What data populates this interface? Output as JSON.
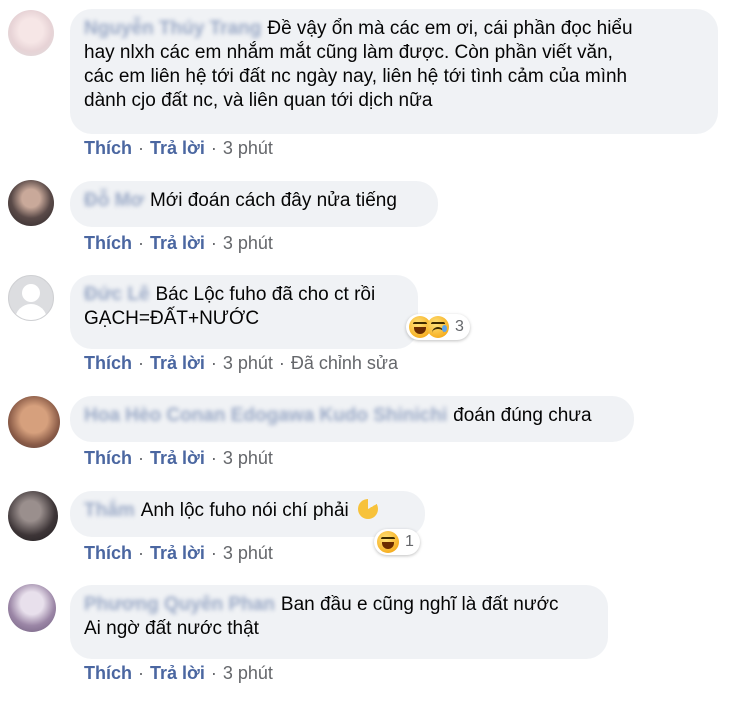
{
  "colors": {
    "link": "#4b67a1",
    "meta": "#65676b",
    "bubble": "#f0f2f5"
  },
  "actions": {
    "like": "Thích",
    "reply": "Trả lời",
    "dot": "·"
  },
  "comments": [
    {
      "author": "Nguyễn Thúy Trang",
      "lines": [
        "Đề vậy ổn mà các em ơi, cái phần đọc hiểu",
        "hay nlxh các em nhắm mắt cũng làm được. Còn phần viết văn,",
        "các em liên hệ tới đất nc ngày nay, liên hệ tới tình cảm của mình",
        "dành cjo đất nc, và liên quan tới dịch nữa"
      ],
      "time": "3 phút"
    },
    {
      "author": "Đỗ Mơ",
      "lines": [
        "Mới đoán cách đây nửa tiếng"
      ],
      "time": "3 phút"
    },
    {
      "author": "Đức Lê",
      "lines": [
        "Bác Lộc fuho đã cho ct rồi",
        "GẠCH=ĐẤT+NƯỚC"
      ],
      "time": "3 phút",
      "edited": "Đã chỉnh sửa",
      "reaction_icons": [
        "haha-icon",
        "sad-icon"
      ],
      "reaction_count": "3"
    },
    {
      "author": "Hoa Hèo Conan Edogawa Kudo Shinichi",
      "lines": [
        "đoán đúng chưa"
      ],
      "time": "3 phút"
    },
    {
      "author": "Thắm",
      "lines": [
        "Anh lộc fuho nói chí phải"
      ],
      "time": "3 phút",
      "reaction_icons": [
        "haha-icon"
      ],
      "reaction_count": "1"
    },
    {
      "author": "Phương Quyên Phan",
      "lines": [
        "Ban đầu e cũng nghĩ là đất nước",
        "Ai ngờ đất nước thật"
      ],
      "time": "3 phút"
    }
  ]
}
